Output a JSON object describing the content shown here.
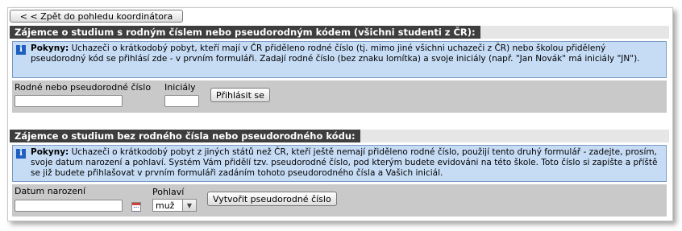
{
  "back_button": {
    "label": "< < Zpět do pohledu koordinátora"
  },
  "section1": {
    "title": "Zájemce o studium s rodným číslem nebo pseudorodným kódem (všichni studenti z ČR):",
    "info_label": "Pokyny:",
    "info_text": " Uchazeči o krátkodobý pobyt, kteří mají v ČR přiděleno rodné číslo (tj. mimo jiné všichni uchazeči z ČR) nebo školou přidělený pseudorodný kód se přihlásí zde - v prvním formuláři. Zadají rodné číslo (bez znaku lomítka) a svoje iniciály (např. \"Jan Novák\" má iniciály \"JN\").",
    "birth_number_label": "Rodné nebo pseudorodné číslo",
    "birth_number_value": "",
    "initials_label": "Iniciály",
    "initials_value": "",
    "login_button": "Přihlásit se"
  },
  "section2": {
    "title": "Zájemce o studium bez rodného čísla nebo pseudorodného kódu:",
    "info_label": "Pokyny:",
    "info_text": " Uchazeči o krátkodobý pobyt z jiných států než ČR, kteří ještě nemají přiděleno rodné číslo, použijí tento druhý formulář - zadejte, prosím, svoje datum narození a pohlaví. Systém Vám přidělí tzv. pseudorodné číslo, pod kterým budete evidováni na této škole. Toto číslo si zapište a příště se již budete přihlašovat v prvním formuláři zadáním tohoto pseudorodného čísla a Vašich iniciál.",
    "birth_date_label": "Datum narození",
    "birth_date_value": "",
    "gender_label": "Pohlaví",
    "gender_selected": "muž",
    "create_button": "Vytvořit pseudorodné číslo"
  },
  "icons": {
    "info": "info-icon",
    "calendar": "calendar-icon",
    "dropdown": "chevron-down-icon"
  },
  "colors": {
    "title_bar": "#3e3e3e",
    "info_bg": "#c6dcf5",
    "form_bg": "#c9c9c9"
  }
}
